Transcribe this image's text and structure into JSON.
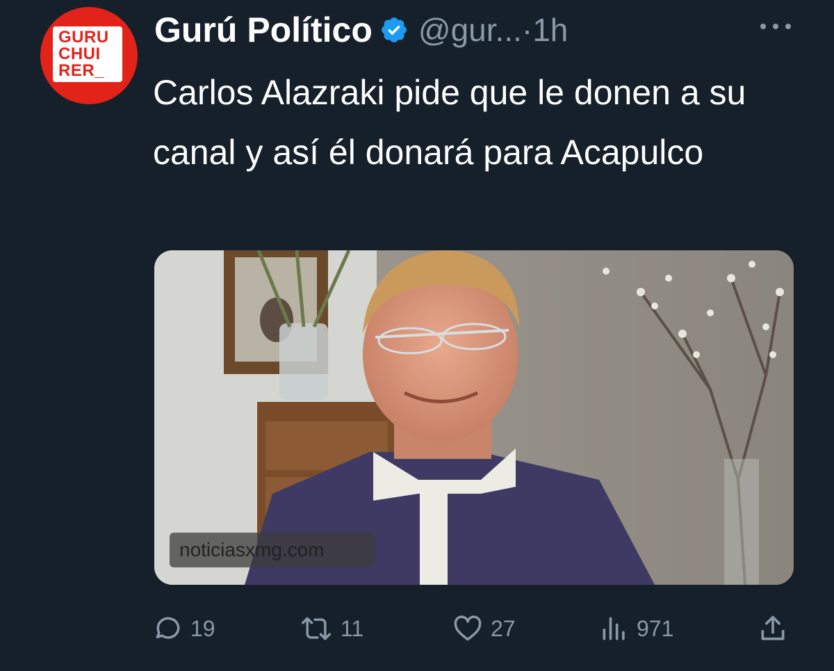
{
  "tweet": {
    "avatar_lines": [
      "GURU",
      "CHUI",
      "RER_"
    ],
    "display_name": "Gurú Político",
    "handle": "@gur...",
    "time": "·1h",
    "text": "Carlos Alazraki pide que le donen a su canal y así él donará para Acapulco",
    "media": {
      "watermark": "noticiasxmg.com"
    },
    "stats": {
      "replies": "19",
      "retweets": "11",
      "likes": "27",
      "views": "971"
    }
  },
  "colors": {
    "background": "#15202b",
    "text": "#ffffff",
    "secondary": "#8b98a5",
    "verified": "#1d9bf0",
    "avatar_red": "#e2231a"
  },
  "icons": {
    "verified": "verified-badge-icon",
    "more": "more-dots-icon",
    "reply": "reply-bubble-icon",
    "retweet": "retweet-icon",
    "like": "heart-icon",
    "views": "views-bars-icon",
    "share": "share-upload-icon"
  }
}
